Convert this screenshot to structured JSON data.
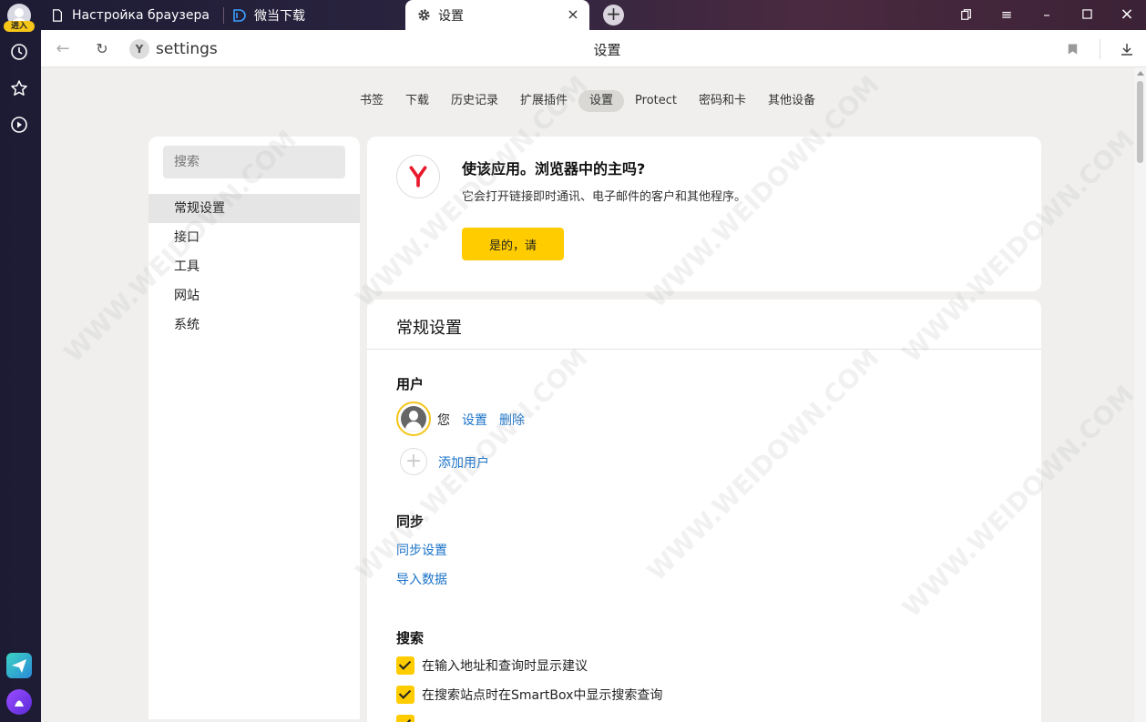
{
  "rail": {
    "login_badge": "进入",
    "icons": [
      "clock-icon",
      "star-icon",
      "play-icon"
    ]
  },
  "tabs": [
    {
      "label": "Настройка браузера",
      "icon": "document-icon",
      "active": false
    },
    {
      "label": "微当下载",
      "icon": "weidown-logo-icon",
      "active": false
    },
    {
      "label": "设置",
      "icon": "gear-icon",
      "active": true
    }
  ],
  "toolbar": {
    "address": "settings",
    "page_title": "设置"
  },
  "nav": {
    "items": [
      {
        "label": "书签",
        "active": false
      },
      {
        "label": "下载",
        "active": false
      },
      {
        "label": "历史记录",
        "active": false
      },
      {
        "label": "扩展插件",
        "active": false
      },
      {
        "label": "设置",
        "active": true
      },
      {
        "label": "Protect",
        "active": false
      },
      {
        "label": "密码和卡",
        "active": false
      },
      {
        "label": "其他设备",
        "active": false
      }
    ]
  },
  "sidebar": {
    "search_placeholder": "搜索",
    "items": [
      {
        "label": "常规设置",
        "active": true
      },
      {
        "label": "接口",
        "active": false
      },
      {
        "label": "工具",
        "active": false
      },
      {
        "label": "网站",
        "active": false
      },
      {
        "label": "系统",
        "active": false
      }
    ]
  },
  "promo": {
    "title": "使该应用。浏览器中的主吗?",
    "description": "它会打开链接即时通讯、电子邮件的客户和其他程序。",
    "yes_label": "是的，请"
  },
  "general": {
    "title": "常规设置",
    "users": {
      "title": "用户",
      "name": "您",
      "settings_link": "设置",
      "delete_link": "删除",
      "add_user": "添加用户"
    },
    "sync": {
      "title": "同步",
      "sync_settings": "同步设置",
      "import_data": "导入数据"
    },
    "search": {
      "title": "搜索",
      "options": [
        {
          "label": "在输入地址和查询时显示建议",
          "checked": true
        },
        {
          "label": "在搜索站点时在SmartBox中显示搜索查询",
          "checked": true
        }
      ]
    }
  },
  "colors": {
    "accent": "#ffcc00",
    "link": "#1a73c8",
    "yandex_red": "#e8192c"
  },
  "watermark": "WWW.WEIDOWN.COM"
}
